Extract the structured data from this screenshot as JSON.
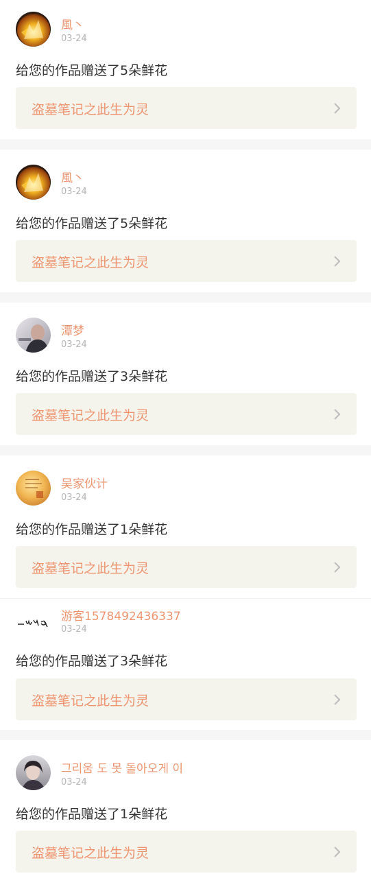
{
  "notifications": [
    {
      "user": "風丶",
      "avatar": "flame-avatar",
      "date": "03-24",
      "message": "给您的作品赠送了5朵鲜花",
      "work_title": "盗墓笔记之此生为灵"
    },
    {
      "user": "風丶",
      "avatar": "flame-avatar",
      "date": "03-24",
      "message": "给您的作品赠送了5朵鲜花",
      "work_title": "盗墓笔记之此生为灵"
    },
    {
      "user": "潭梦",
      "avatar": "portrait-avatar",
      "date": "03-24",
      "message": "给您的作品赠送了3朵鲜花",
      "work_title": "盗墓笔记之此生为灵"
    },
    {
      "user": "吴家伙计",
      "avatar": "golden-avatar",
      "date": "03-24",
      "message": "给您的作品赠送了1朵鲜花",
      "work_title": "盗墓笔记之此生为灵"
    },
    {
      "user": "游客1578492436337",
      "avatar": "calligraphy-avatar",
      "date": "03-24",
      "message": "给您的作品赠送了3朵鲜花",
      "work_title": "盗墓笔记之此生为灵"
    },
    {
      "user": "그리움 도 못 돌아오게 이",
      "avatar": "girl-avatar",
      "date": "03-24",
      "message": "给您的作品赠送了1朵鲜花",
      "work_title": "盗墓笔记之此生为灵"
    }
  ],
  "colors": {
    "accent": "#ee9570",
    "work_card_bg": "#f4f3ec",
    "page_bg": "#f6f6f6"
  },
  "icons": {
    "chevron": "chevron-right-icon"
  }
}
